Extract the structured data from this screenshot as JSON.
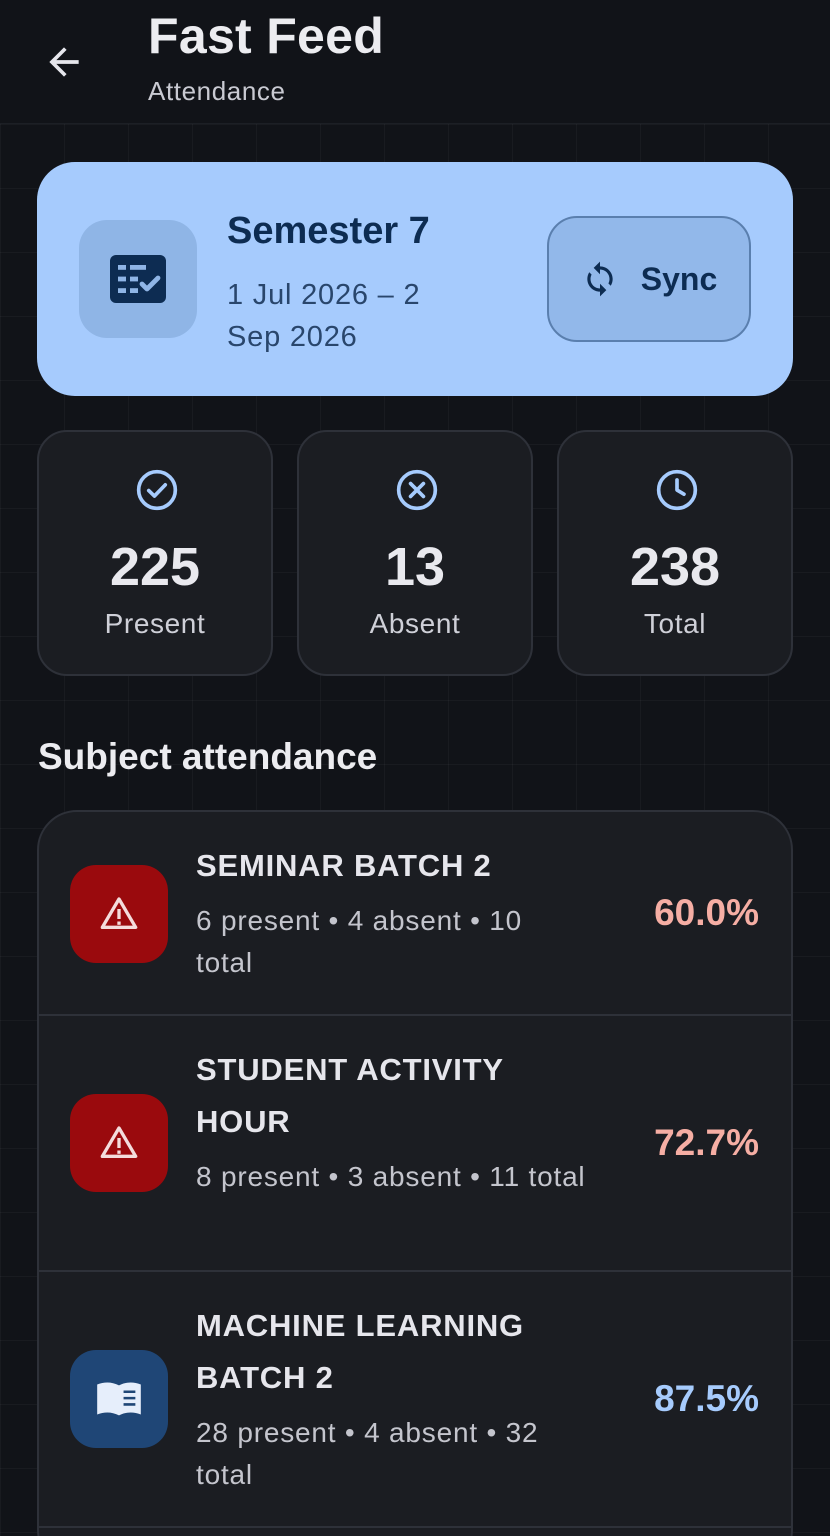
{
  "header": {
    "title": "Fast Feed",
    "subtitle": "Attendance"
  },
  "semester": {
    "title": "Semester 7",
    "dates": "1 Jul 2026 – 2 Sep 2026",
    "sync_label": "Sync",
    "card_color": "#a6cbfd"
  },
  "stats": [
    {
      "value": "225",
      "label": "Present",
      "icon": "check-circle-icon"
    },
    {
      "value": "13",
      "label": "Absent",
      "icon": "cancel-circle-icon"
    },
    {
      "value": "238",
      "label": "Total",
      "icon": "clock-icon"
    }
  ],
  "section_title": "Subject attendance",
  "subjects": [
    {
      "name": "SEMINAR BATCH 2",
      "detail": "6 present • 4 absent • 10 total",
      "percent": "60.0%",
      "status": "warning",
      "icon": "warning-icon",
      "color": "#f6aea4"
    },
    {
      "name": "STUDENT ACTIVITY HOUR",
      "detail": "8 present • 3 absent • 11 total",
      "percent": "72.7%",
      "status": "warning",
      "icon": "warning-icon",
      "color": "#f6aea4"
    },
    {
      "name": "MACHINE LEARNING BATCH 2",
      "detail": "28 present • 4 absent • 32 total",
      "percent": "87.5%",
      "status": "ok",
      "icon": "book-icon",
      "color": "#a6cbfd"
    }
  ]
}
